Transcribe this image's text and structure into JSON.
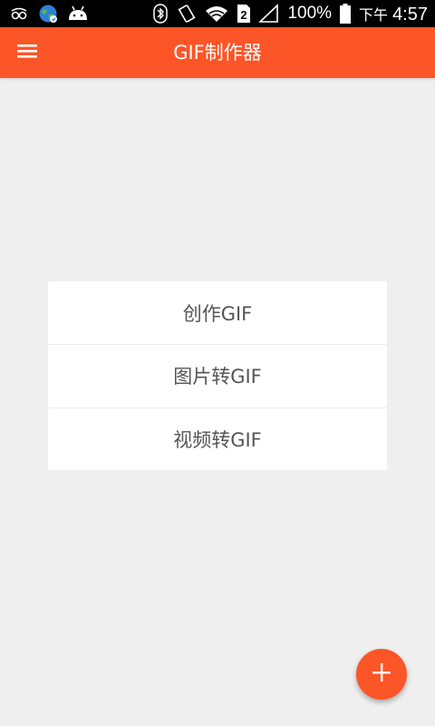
{
  "status_bar": {
    "icons_left": [
      "glasses-icon",
      "globe-icon",
      "android-icon"
    ],
    "icons_right": [
      "bluetooth-icon",
      "vibrate-icon",
      "wifi-icon",
      "sim-icon",
      "signal-icon",
      "battery-icon"
    ],
    "battery": "100%",
    "ampm": "下午",
    "time": "4:57"
  },
  "app_bar": {
    "title": "GIF制作器",
    "background": "#fc5527"
  },
  "menu": {
    "items": [
      {
        "label": "创作GIF"
      },
      {
        "label": "图片转GIF"
      },
      {
        "label": "视频转GIF"
      }
    ]
  },
  "fab": {
    "icon": "plus-icon",
    "color": "#fc5527"
  }
}
